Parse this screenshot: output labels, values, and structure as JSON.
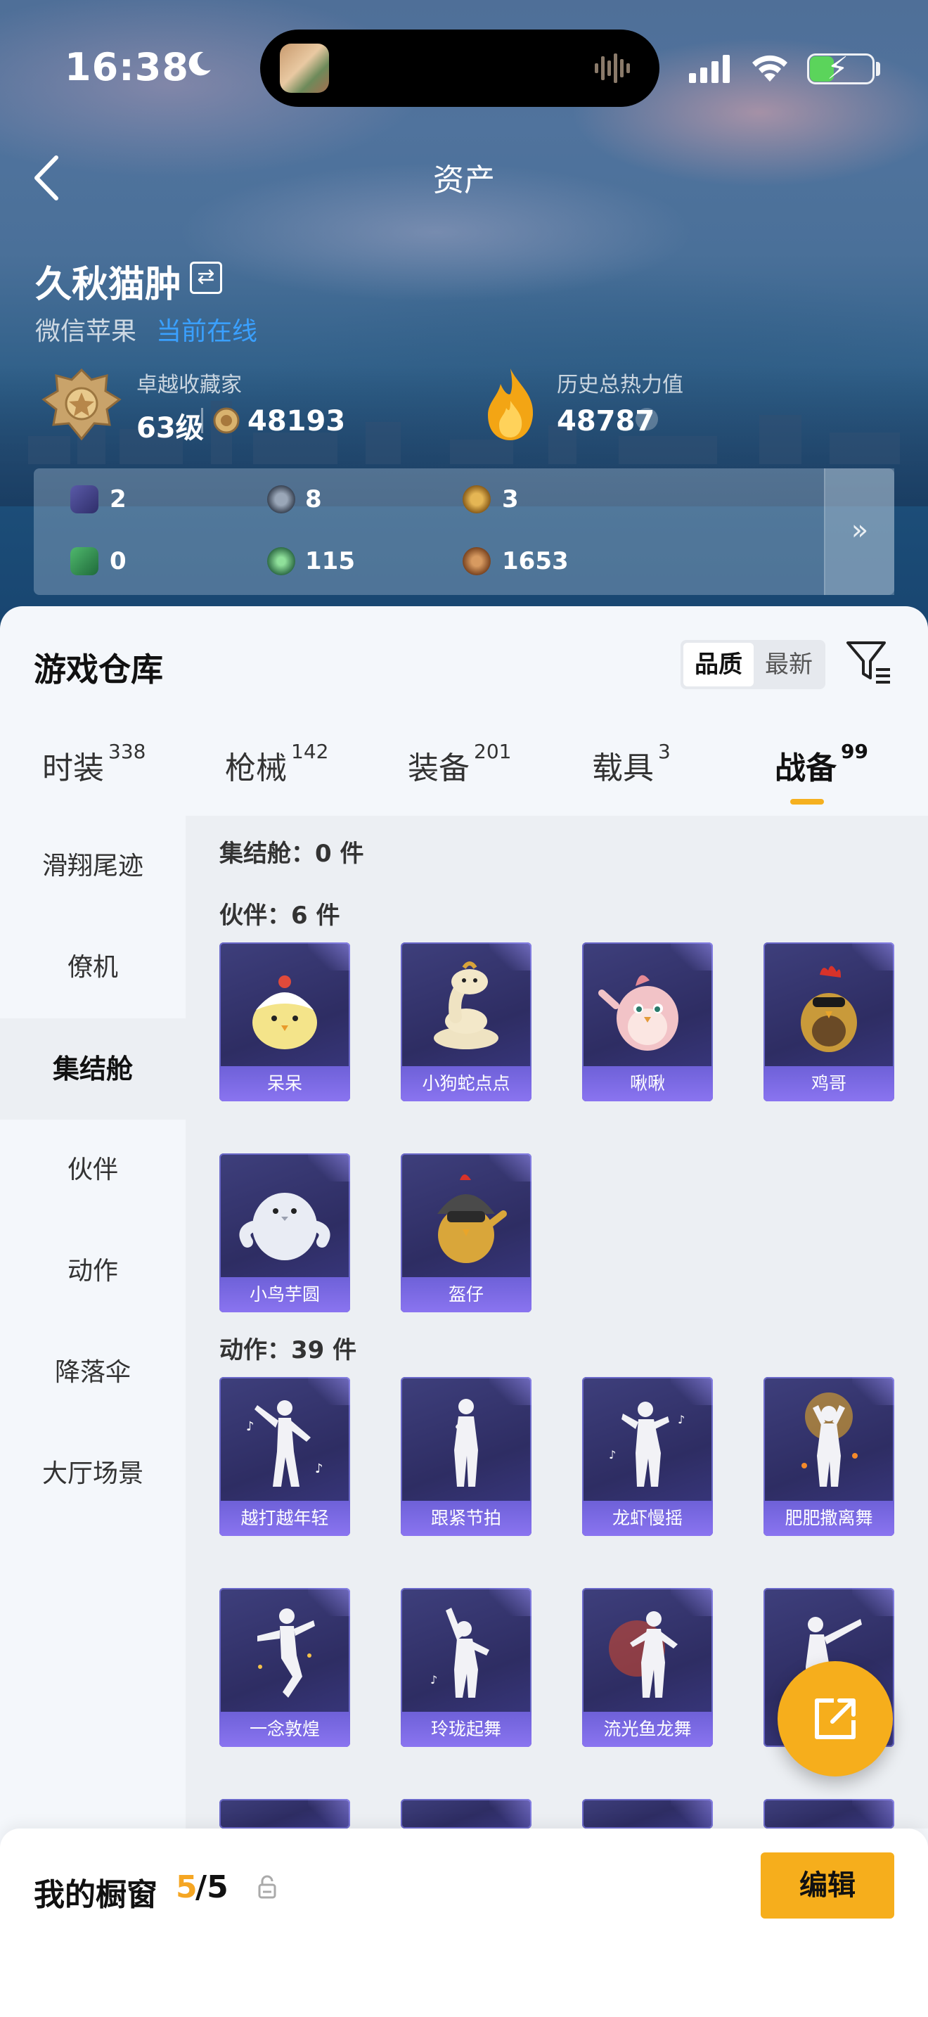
{
  "status_bar": {
    "time": "16:38"
  },
  "nav": {
    "title": "资产"
  },
  "player": {
    "name": "久秋猫肿",
    "platform": "微信苹果",
    "online_status": "当前在线"
  },
  "stats": {
    "collector_title": "卓越收藏家",
    "level": "63级",
    "coins": "48193",
    "heat_title": "历史总热力值",
    "heat_value": "48787"
  },
  "currencies": [
    {
      "icon": "card-icon",
      "value": "2"
    },
    {
      "icon": "s-coin-icon",
      "value": "8"
    },
    {
      "icon": "a-coin-icon",
      "value": "3"
    },
    {
      "icon": "green-ticket-icon",
      "value": "0"
    },
    {
      "icon": "green-orb-icon",
      "value": "115"
    },
    {
      "icon": "bronze-coin-icon",
      "value": "1653"
    }
  ],
  "warehouse": {
    "title": "游戏仓库",
    "sort": {
      "quality": "品质",
      "newest": "最新"
    },
    "tabs": [
      {
        "label": "时装",
        "count": "338"
      },
      {
        "label": "枪械",
        "count": "142"
      },
      {
        "label": "装备",
        "count": "201"
      },
      {
        "label": "载具",
        "count": "3"
      },
      {
        "label": "战备",
        "count": "99",
        "active": true
      }
    ],
    "sidebar": [
      "滑翔尾迹",
      "僚机",
      "集结舱",
      "伙伴",
      "动作",
      "降落伞",
      "大厅场景"
    ],
    "sections": {
      "rally": "集结舱：0 件",
      "partner": "伙伴：6 件",
      "action": "动作：39 件"
    },
    "partners": [
      "呆呆",
      "小狗蛇点点",
      "啾啾",
      "鸡哥",
      "小鸟芋圆",
      "盔仔"
    ],
    "actions": [
      "越打越年轻",
      "跟紧节拍",
      "龙虾慢摇",
      "肥肥撒离舞",
      "一念敦煌",
      "玲珑起舞",
      "流光鱼龙舞"
    ]
  },
  "showcase": {
    "label": "我的橱窗",
    "current": "5",
    "total": "/5",
    "edit": "编辑"
  },
  "colors": {
    "accent": "#f6ae1c",
    "card": "#3e3f7c",
    "card_label": "#7a6be2",
    "online": "#3aa0ff"
  }
}
